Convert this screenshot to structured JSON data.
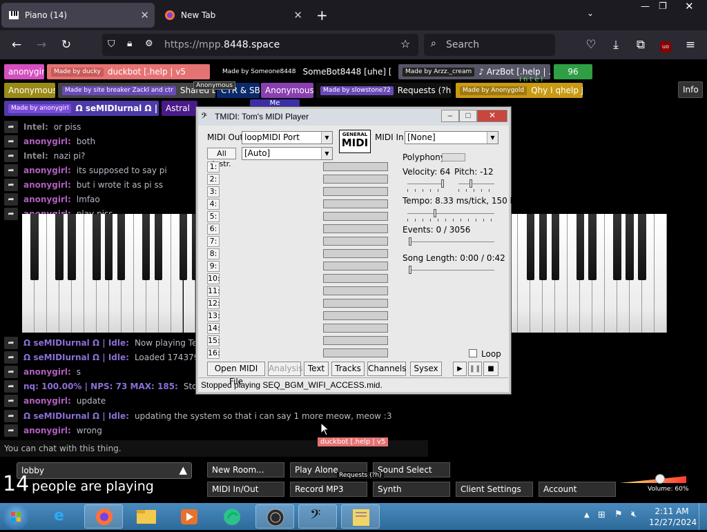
{
  "browser": {
    "tabs": [
      {
        "label": "Piano (14)"
      },
      {
        "label": "New Tab"
      }
    ],
    "url_prefix": "https://mpp.",
    "url_domain": "8448.space",
    "search_placeholder": "Search"
  },
  "people": {
    "row1": [
      {
        "label": "anonygirl",
        "color": "#d44fbf"
      },
      {
        "tag": "Made by ducky",
        "label": "duckbot [.help | v5",
        "color": "#e57373"
      },
      {
        "tag": "Made by Someone8448",
        "label": "SomeBot8448 [uhe] [",
        "color": "#000000"
      },
      {
        "tag": "Made by Arzz._cream",
        "label": "♪ ArzBot [.help | .",
        "color": "#555566"
      },
      {
        "label": "96",
        "color": "#2f9e44"
      }
    ],
    "row2": [
      {
        "label": "Anonymous",
        "color": "#9a8a16"
      },
      {
        "tag": "Made by site breaker Zackl and ctr",
        "label": "Shared bot",
        "color": "#444"
      },
      {
        "label": "CTR & SB",
        "color": "#0a2a6a"
      },
      {
        "label": "Anonymous",
        "color": "#8a3fb0"
      },
      {
        "tag": "Made by slowstone72",
        "label": "Requests (?h)",
        "color": "#111"
      },
      {
        "tag": "Made by Anonygold",
        "label": "Qhy I qhelp J",
        "color": "#c89a14"
      }
    ],
    "row3": [
      {
        "tag": "Made by anonygirl",
        "label": "Ω seMIDIurnal Ω | Idle",
        "color": "#4e3aa8"
      },
      {
        "label": "Astral",
        "color": "#4b1a8a"
      },
      {
        "label": "Me",
        "color": "#3b2fa8"
      }
    ],
    "hover_tip": "Anonymous",
    "info_label": "Info",
    "intel_label": "Intel"
  },
  "chat": [
    {
      "name": "Intel:",
      "msg": "or piss",
      "color": "#888"
    },
    {
      "name": "anonygirl:",
      "msg": "both",
      "color": "#b15fbf"
    },
    {
      "name": "Intel:",
      "msg": "nazi pi?",
      "color": "#888"
    },
    {
      "name": "anonygirl:",
      "msg": "its supposed to say pi",
      "color": "#b15fbf"
    },
    {
      "name": "anonygirl:",
      "msg": "but i wrote it as pi ss",
      "color": "#b15fbf"
    },
    {
      "name": "anonygirl:",
      "msg": "lmfao",
      "color": "#b15fbf"
    },
    {
      "name": "anonygirl:",
      "msg": "play piss",
      "color": "#b15fbf"
    },
    {
      "name": "Ω seMIDIurnal Ω | Idle:",
      "msg": "Now playing Te",
      "color": "#8a6fd8"
    },
    {
      "name": "Ω seMIDIurnal Ω | Idle:",
      "msg": "Loaded 174379",
      "color": "#8a6fd8"
    },
    {
      "name": "anonygirl:",
      "msg": "s",
      "color": "#b15fbf"
    },
    {
      "name": "nq: 100.00% | NPS: 73 MAX: 185:",
      "msg": "Stopp",
      "color": "#8a6fd8"
    },
    {
      "name": "anonygirl:",
      "msg": "update",
      "color": "#b15fbf"
    },
    {
      "name": "Ω seMIDIurnal Ω | Idle:",
      "msg": "updating the system so that i can say 1 more meow, meow :3",
      "color": "#8a6fd8"
    },
    {
      "name": "anonygirl:",
      "msg": "wrong",
      "color": "#b15fbf"
    }
  ],
  "chat_hint": "You can chat with this thing.",
  "cursor_tag": "duckbot [.help | v5",
  "room": {
    "name": "lobby",
    "count": "14",
    "count_suffix": "people are playing"
  },
  "bottom_buttons": {
    "new_room": "New Room...",
    "play_alone": "Play Alone",
    "sound_select": "Sound Select",
    "midi_inout": "MIDI In/Out",
    "record_mp3": "Record MP3",
    "synth": "Synth",
    "client_settings": "Client Settings",
    "account": "Account",
    "requests_tip": "Requests (?h)",
    "volume_label": "Volume: 60%",
    "volume_level": 0.6
  },
  "tmidi": {
    "title": "TMIDI: Tom's MIDI Player",
    "midi_out_label": "MIDI Out:",
    "midi_out_value": "loopMIDI Port",
    "all_instr_label": "All Instr.",
    "instr_value": "[Auto]",
    "midi_in_label": "MIDI In:",
    "midi_in_value": "[None]",
    "logo_top": "GENERAL",
    "logo_bottom": "MIDI",
    "polyphony_label": "Polyphony:",
    "velocity_label": "Velocity: 64",
    "pitch_label": "Pitch: -12",
    "tempo_label": "Tempo: 8.33 ms/tick, 150 bpm",
    "events_label": "Events: 0 / 3056",
    "song_length_label": "Song Length: 0:00 / 0:42",
    "channels": [
      "1:",
      "2:",
      "3:",
      "4:",
      "5:",
      "6:",
      "7:",
      "8:",
      "9:",
      "10:",
      "11:",
      "12:",
      "13:",
      "14:",
      "15:",
      "16:"
    ],
    "loop_label": "Loop",
    "buttons": {
      "open": "Open MIDI File",
      "analysis": "Analysis",
      "text": "Text",
      "tracks": "Tracks",
      "channels": "Channels",
      "sysex": "Sysex"
    },
    "status": "Stopped playing SEQ_BGM_WIFI_ACCESS.mid."
  },
  "taskbar": {
    "time": "2:11 AM",
    "date": "12/27/2024"
  }
}
